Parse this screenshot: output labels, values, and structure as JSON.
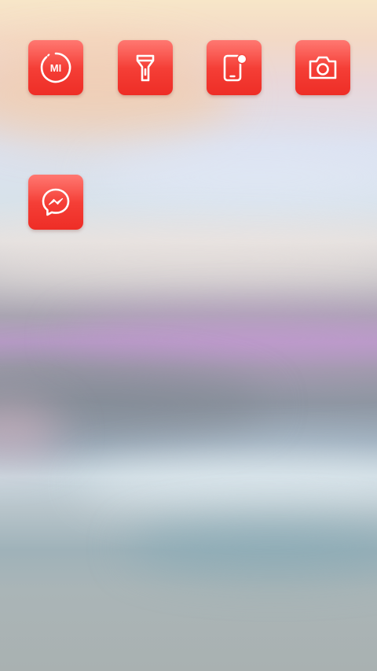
{
  "home_screen": {
    "apps": [
      {
        "icon": "mi-icon",
        "badge_text": "MI"
      },
      {
        "icon": "flashlight-icon"
      },
      {
        "icon": "phone-notification-icon"
      },
      {
        "icon": "camera-icon"
      },
      {
        "icon": "messenger-icon"
      }
    ]
  },
  "colors": {
    "icon_background": "#f43d35",
    "icon_glyph": "#ffffff"
  }
}
